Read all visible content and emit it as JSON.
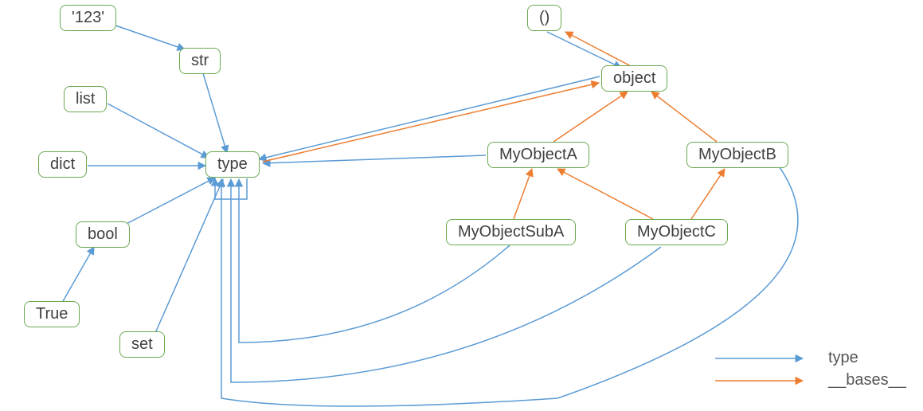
{
  "nodes": {
    "n123": {
      "label": "'123'"
    },
    "str": {
      "label": "str"
    },
    "list": {
      "label": "list"
    },
    "dict": {
      "label": "dict"
    },
    "type": {
      "label": "type"
    },
    "bool": {
      "label": "bool"
    },
    "true": {
      "label": "True"
    },
    "set": {
      "label": "set"
    },
    "empty_tuple": {
      "label": "()"
    },
    "object": {
      "label": "object"
    },
    "myA": {
      "label": "MyObjectA"
    },
    "myB": {
      "label": "MyObjectB"
    },
    "mySubA": {
      "label": "MyObjectSubA"
    },
    "myC": {
      "label": "MyObjectC"
    }
  },
  "legend": {
    "type": "type",
    "bases": "__bases__"
  },
  "colors": {
    "type_edge": "#5b9bd5",
    "bases_edge": "#ed7d31",
    "node_border": "#6aa84f"
  },
  "chart_data": {
    "type": "graph",
    "title": "",
    "nodes": [
      "'123'",
      "str",
      "list",
      "dict",
      "type",
      "bool",
      "True",
      "set",
      "()",
      "object",
      "MyObjectA",
      "MyObjectB",
      "MyObjectSubA",
      "MyObjectC"
    ],
    "edges_type": [
      [
        "'123'",
        "str"
      ],
      [
        "str",
        "type"
      ],
      [
        "list",
        "type"
      ],
      [
        "dict",
        "type"
      ],
      [
        "bool",
        "type"
      ],
      [
        "True",
        "bool"
      ],
      [
        "set",
        "type"
      ],
      [
        "type",
        "type"
      ],
      [
        "()",
        "object"
      ],
      [
        "object",
        "type"
      ],
      [
        "MyObjectA",
        "type"
      ],
      [
        "MyObjectB",
        "type"
      ],
      [
        "MyObjectSubA",
        "type"
      ],
      [
        "MyObjectC",
        "type"
      ]
    ],
    "edges_bases": [
      [
        "type",
        "object"
      ],
      [
        "object",
        "()"
      ],
      [
        "MyObjectA",
        "object"
      ],
      [
        "MyObjectB",
        "object"
      ],
      [
        "MyObjectSubA",
        "MyObjectA"
      ],
      [
        "MyObjectC",
        "MyObjectA"
      ],
      [
        "MyObjectC",
        "MyObjectB"
      ]
    ],
    "legend": [
      {
        "label": "type",
        "color": "#5b9bd5"
      },
      {
        "label": "__bases__",
        "color": "#ed7d31"
      }
    ]
  }
}
